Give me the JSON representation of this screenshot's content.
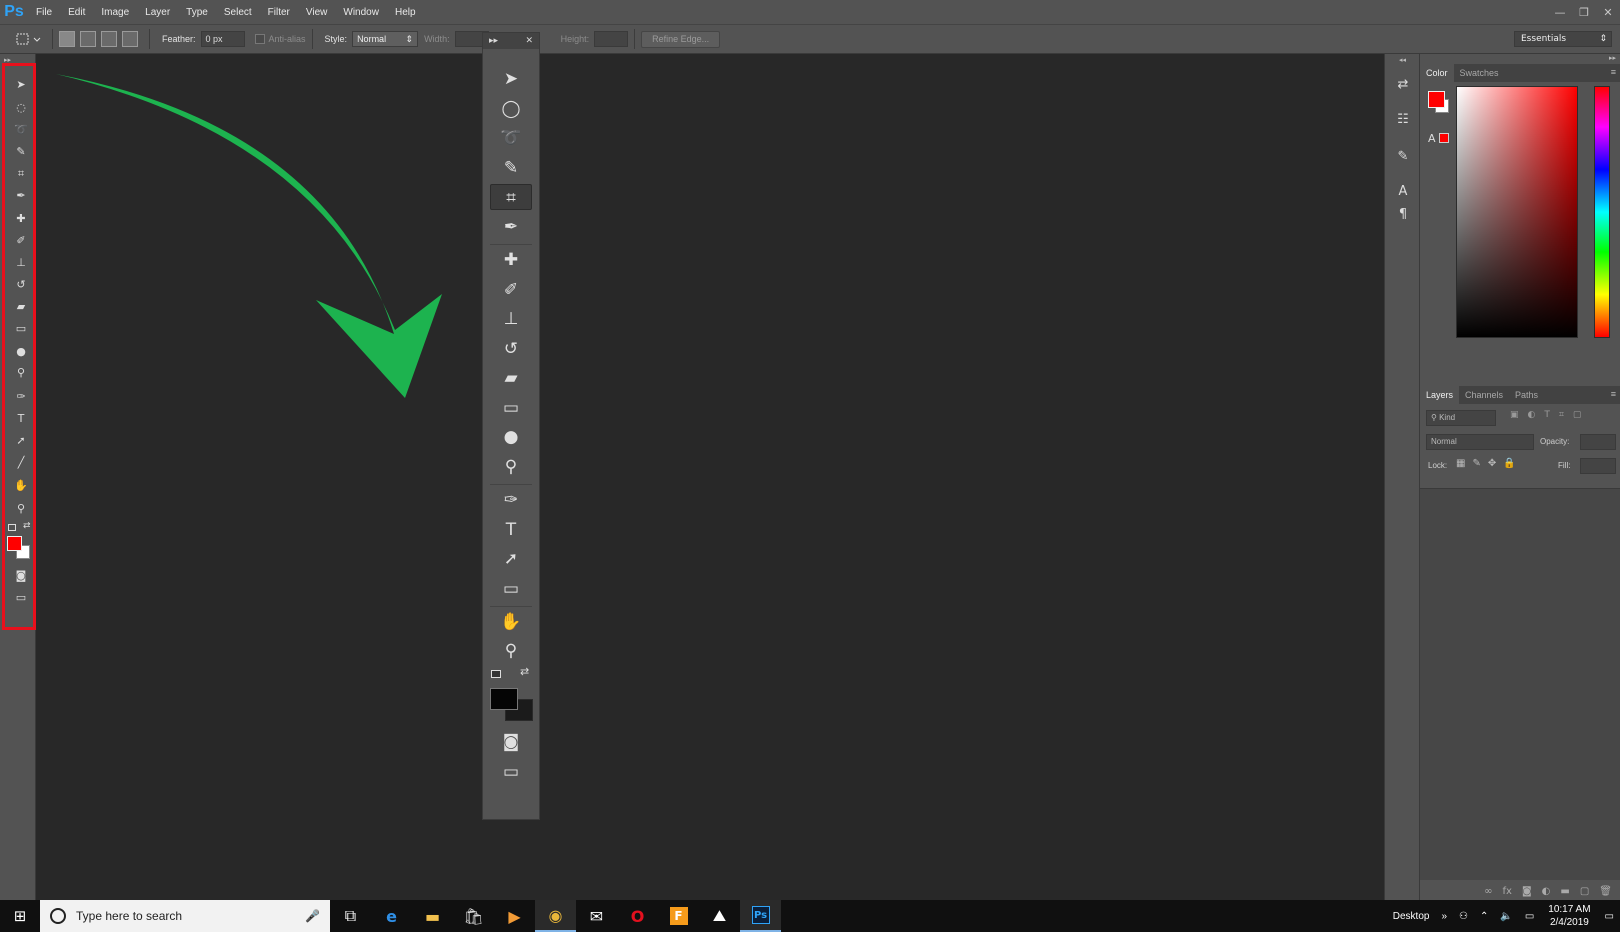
{
  "app": {
    "logo": "Ps",
    "brand_color": "#2fa3f7"
  },
  "menu": [
    "File",
    "Edit",
    "Image",
    "Layer",
    "Type",
    "Select",
    "Filter",
    "View",
    "Window",
    "Help"
  ],
  "window_controls": {
    "minimize": "—",
    "restore": "❐",
    "close": "✕"
  },
  "options": {
    "feather_label": "Feather:",
    "feather_value": "0 px",
    "antialias_label": "Anti-alias",
    "style_label": "Style:",
    "style_value": "Normal",
    "width_label": "Width:",
    "height_label": "Height:",
    "refine_edge": "Refine Edge...",
    "workspace": "Essentials"
  },
  "floating_toolbar": {
    "collapse": "▸▸",
    "close": "✕"
  },
  "color_panel": {
    "tabs": [
      "Color",
      "Swatches"
    ],
    "foreground": "#ff0000",
    "background": "#ffffff"
  },
  "layers_panel": {
    "tabs": [
      "Layers",
      "Channels",
      "Paths"
    ],
    "filter": "Kind",
    "blend_mode": "Normal",
    "opacity_label": "Opacity:",
    "lock_label": "Lock:",
    "fill_label": "Fill:"
  },
  "highlight_color": "#e8101c",
  "arrow_color": "#1db34f",
  "taskbar": {
    "search_placeholder": "Type here to search",
    "desktop_label": "Desktop",
    "time": "10:17 AM",
    "date": "2/4/2019"
  }
}
